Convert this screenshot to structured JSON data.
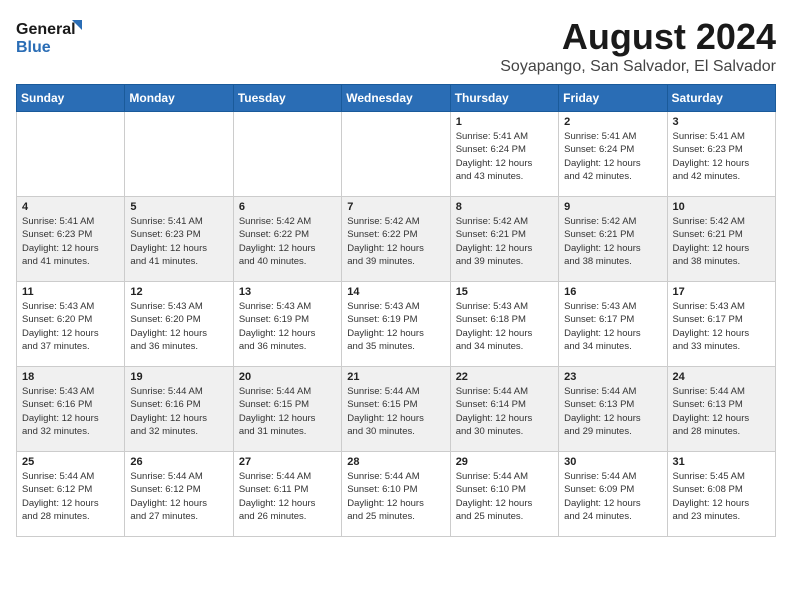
{
  "logo": {
    "line1": "General",
    "line2": "Blue"
  },
  "title": "August 2024",
  "location": "Soyapango, San Salvador, El Salvador",
  "weekdays": [
    "Sunday",
    "Monday",
    "Tuesday",
    "Wednesday",
    "Thursday",
    "Friday",
    "Saturday"
  ],
  "weeks": [
    [
      {
        "day": "",
        "detail": ""
      },
      {
        "day": "",
        "detail": ""
      },
      {
        "day": "",
        "detail": ""
      },
      {
        "day": "",
        "detail": ""
      },
      {
        "day": "1",
        "detail": "Sunrise: 5:41 AM\nSunset: 6:24 PM\nDaylight: 12 hours\nand 43 minutes."
      },
      {
        "day": "2",
        "detail": "Sunrise: 5:41 AM\nSunset: 6:24 PM\nDaylight: 12 hours\nand 42 minutes."
      },
      {
        "day": "3",
        "detail": "Sunrise: 5:41 AM\nSunset: 6:23 PM\nDaylight: 12 hours\nand 42 minutes."
      }
    ],
    [
      {
        "day": "4",
        "detail": "Sunrise: 5:41 AM\nSunset: 6:23 PM\nDaylight: 12 hours\nand 41 minutes."
      },
      {
        "day": "5",
        "detail": "Sunrise: 5:41 AM\nSunset: 6:23 PM\nDaylight: 12 hours\nand 41 minutes."
      },
      {
        "day": "6",
        "detail": "Sunrise: 5:42 AM\nSunset: 6:22 PM\nDaylight: 12 hours\nand 40 minutes."
      },
      {
        "day": "7",
        "detail": "Sunrise: 5:42 AM\nSunset: 6:22 PM\nDaylight: 12 hours\nand 39 minutes."
      },
      {
        "day": "8",
        "detail": "Sunrise: 5:42 AM\nSunset: 6:21 PM\nDaylight: 12 hours\nand 39 minutes."
      },
      {
        "day": "9",
        "detail": "Sunrise: 5:42 AM\nSunset: 6:21 PM\nDaylight: 12 hours\nand 38 minutes."
      },
      {
        "day": "10",
        "detail": "Sunrise: 5:42 AM\nSunset: 6:21 PM\nDaylight: 12 hours\nand 38 minutes."
      }
    ],
    [
      {
        "day": "11",
        "detail": "Sunrise: 5:43 AM\nSunset: 6:20 PM\nDaylight: 12 hours\nand 37 minutes."
      },
      {
        "day": "12",
        "detail": "Sunrise: 5:43 AM\nSunset: 6:20 PM\nDaylight: 12 hours\nand 36 minutes."
      },
      {
        "day": "13",
        "detail": "Sunrise: 5:43 AM\nSunset: 6:19 PM\nDaylight: 12 hours\nand 36 minutes."
      },
      {
        "day": "14",
        "detail": "Sunrise: 5:43 AM\nSunset: 6:19 PM\nDaylight: 12 hours\nand 35 minutes."
      },
      {
        "day": "15",
        "detail": "Sunrise: 5:43 AM\nSunset: 6:18 PM\nDaylight: 12 hours\nand 34 minutes."
      },
      {
        "day": "16",
        "detail": "Sunrise: 5:43 AM\nSunset: 6:17 PM\nDaylight: 12 hours\nand 34 minutes."
      },
      {
        "day": "17",
        "detail": "Sunrise: 5:43 AM\nSunset: 6:17 PM\nDaylight: 12 hours\nand 33 minutes."
      }
    ],
    [
      {
        "day": "18",
        "detail": "Sunrise: 5:43 AM\nSunset: 6:16 PM\nDaylight: 12 hours\nand 32 minutes."
      },
      {
        "day": "19",
        "detail": "Sunrise: 5:44 AM\nSunset: 6:16 PM\nDaylight: 12 hours\nand 32 minutes."
      },
      {
        "day": "20",
        "detail": "Sunrise: 5:44 AM\nSunset: 6:15 PM\nDaylight: 12 hours\nand 31 minutes."
      },
      {
        "day": "21",
        "detail": "Sunrise: 5:44 AM\nSunset: 6:15 PM\nDaylight: 12 hours\nand 30 minutes."
      },
      {
        "day": "22",
        "detail": "Sunrise: 5:44 AM\nSunset: 6:14 PM\nDaylight: 12 hours\nand 30 minutes."
      },
      {
        "day": "23",
        "detail": "Sunrise: 5:44 AM\nSunset: 6:13 PM\nDaylight: 12 hours\nand 29 minutes."
      },
      {
        "day": "24",
        "detail": "Sunrise: 5:44 AM\nSunset: 6:13 PM\nDaylight: 12 hours\nand 28 minutes."
      }
    ],
    [
      {
        "day": "25",
        "detail": "Sunrise: 5:44 AM\nSunset: 6:12 PM\nDaylight: 12 hours\nand 28 minutes."
      },
      {
        "day": "26",
        "detail": "Sunrise: 5:44 AM\nSunset: 6:12 PM\nDaylight: 12 hours\nand 27 minutes."
      },
      {
        "day": "27",
        "detail": "Sunrise: 5:44 AM\nSunset: 6:11 PM\nDaylight: 12 hours\nand 26 minutes."
      },
      {
        "day": "28",
        "detail": "Sunrise: 5:44 AM\nSunset: 6:10 PM\nDaylight: 12 hours\nand 25 minutes."
      },
      {
        "day": "29",
        "detail": "Sunrise: 5:44 AM\nSunset: 6:10 PM\nDaylight: 12 hours\nand 25 minutes."
      },
      {
        "day": "30",
        "detail": "Sunrise: 5:44 AM\nSunset: 6:09 PM\nDaylight: 12 hours\nand 24 minutes."
      },
      {
        "day": "31",
        "detail": "Sunrise: 5:45 AM\nSunset: 6:08 PM\nDaylight: 12 hours\nand 23 minutes."
      }
    ]
  ]
}
